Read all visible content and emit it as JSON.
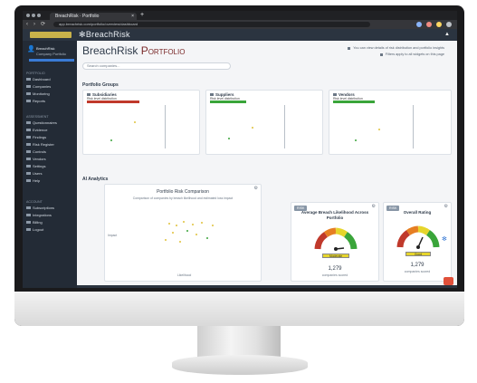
{
  "browser": {
    "tab_title": "BreachRisk · Portfolio",
    "tab_close": "×",
    "new_tab": "+",
    "url": "app.breachrisk.com/portfolio/overview/dashboard",
    "back": "‹",
    "forward": "›",
    "reload": "⟳"
  },
  "header": {
    "brand": "✻BreachRisk",
    "alert_icon": "▲"
  },
  "sidebar": {
    "profile_name": "BreachRisk",
    "profile_org": "Company Portfolio",
    "section_1": "PORTFOLIO",
    "items_1": [
      "Dashboard",
      "Companies",
      "Monitoring",
      "Reports"
    ],
    "section_2": "ASSESSMENT",
    "items_2": [
      "Questionnaires",
      "Evidence",
      "Findings",
      "Risk Register",
      "Controls",
      "Vendors",
      "Settings",
      "Users",
      "Help"
    ],
    "section_3": "ACCOUNT",
    "items_3": [
      "Subscriptions",
      "Integrations",
      "Billing",
      "Logout"
    ]
  },
  "main": {
    "title_plain": "BreachRisk",
    "title_accent": "Portfolio",
    "search_placeholder": "Search companies...",
    "note_1": "You can view details of risk distribution and portfolio insights",
    "note_2": "Filters apply to all widgets on this page",
    "section_portfolio": "Portfolio Groups",
    "section_ai": "AI Analytics",
    "cards": [
      {
        "title": "Subsidiaries",
        "legend": "Risk level distribution"
      },
      {
        "title": "Suppliers",
        "legend": "Risk level distribution"
      },
      {
        "title": "Vendors",
        "legend": "Risk level distribution"
      }
    ],
    "scatter_title": "Portfolio Risk Comparison",
    "scatter_sub": "Comparison of companies by breach likelihood and estimated loss impact",
    "scatter_axis_x": "Likelihood",
    "scatter_axis_y": "Impact",
    "gauges": [
      {
        "badge": "RISK",
        "title": "Average Breach Likelihood Across Portfolio",
        "score": "Moderate",
        "value": "1,279",
        "sub": "companies scored"
      },
      {
        "badge": "RISK",
        "title": "Overall Rating",
        "score": "Good",
        "value": "1,279",
        "sub": "companies scored"
      }
    ]
  },
  "colors": {
    "accent_red": "#c0392b",
    "accent_yellow": "#e6d52c",
    "accent_green": "#3aa53a"
  }
}
